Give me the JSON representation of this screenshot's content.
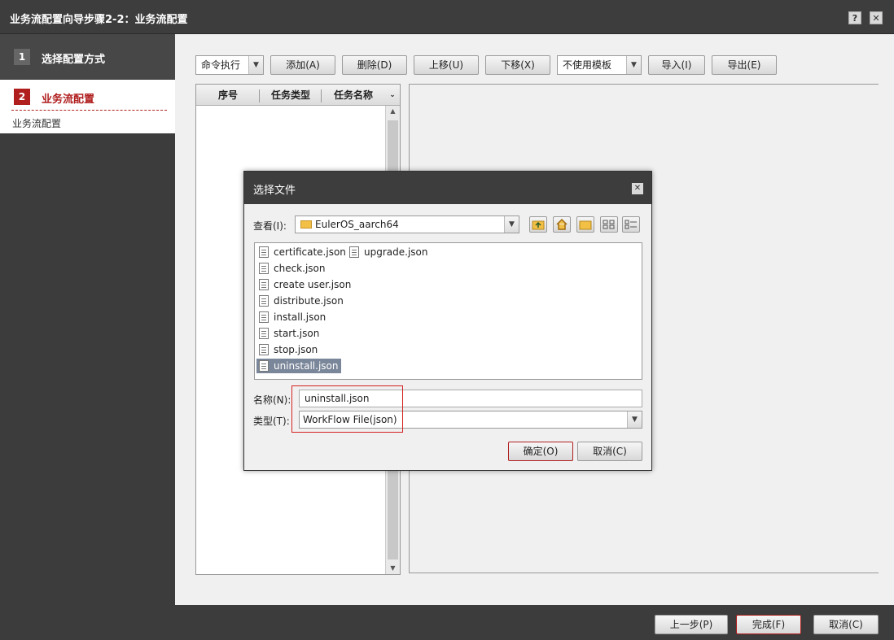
{
  "window": {
    "title": "业务流配置向导步骤2-2：业务流配置",
    "help_label": "?",
    "close_label": "✕"
  },
  "steps": [
    {
      "num": "1",
      "label": "选择配置方式"
    },
    {
      "num": "2",
      "label": "业务流配置",
      "sub": "业务流配置"
    }
  ],
  "toolbar": {
    "exec_type": "命令执行",
    "add": "添加(A)",
    "delete": "删除(D)",
    "move_up": "上移(U)",
    "move_down": "下移(X)",
    "template": "不使用模板",
    "import": "导入(I)",
    "export": "导出(E)"
  },
  "task_table": {
    "columns": [
      "序号",
      "任务类型",
      "任务名称"
    ]
  },
  "footer": {
    "prev": "上一步(P)",
    "finish": "完成(F)",
    "cancel": "取消(C)"
  },
  "dialog": {
    "title": "选择文件",
    "close_label": "✕",
    "look_in_label": "查看(I):",
    "look_in_value": "EulerOS_aarch64",
    "files": [
      {
        "name": "certificate.json"
      },
      {
        "name": "upgrade.json"
      },
      {
        "name": "check.json"
      },
      {
        "name": "create user.json"
      },
      {
        "name": "distribute.json"
      },
      {
        "name": "install.json"
      },
      {
        "name": "start.json"
      },
      {
        "name": "stop.json"
      },
      {
        "name": "uninstall.json",
        "selected": true
      }
    ],
    "name_label": "名称(N):",
    "name_value": "uninstall.json",
    "type_label": "类型(T):",
    "type_value": "WorkFlow File(json)",
    "ok": "确定(O)",
    "cancel": "取消(C)"
  },
  "colors": {
    "accent_red": "#b01e1e",
    "dark_bg": "#3c3c3c",
    "selection": "#7a8699"
  }
}
